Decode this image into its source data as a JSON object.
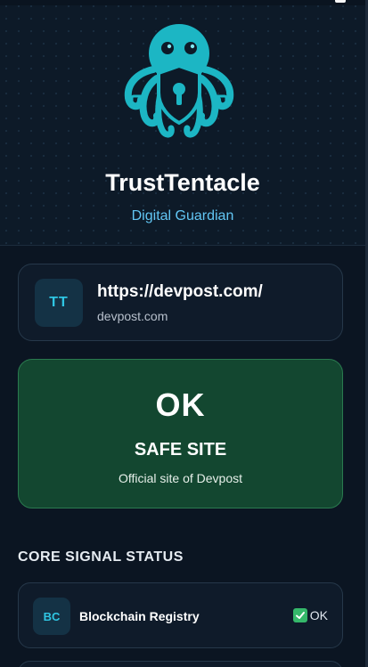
{
  "app": {
    "name": "TrustTentacle",
    "tagline": "Digital Guardian"
  },
  "site": {
    "avatar_text": "TT",
    "url": "https://devpost.com/",
    "domain": "devpost.com"
  },
  "verdict": {
    "status": "OK",
    "title": "SAFE SITE",
    "description": "Official site of Devpost",
    "color": "#134730"
  },
  "signals": {
    "section_title": "CORE SIGNAL STATUS",
    "items": [
      {
        "icon_text": "BC",
        "label": "Blockchain Registry",
        "status": "OK",
        "status_icon": "check-icon"
      }
    ]
  },
  "colors": {
    "accent": "#2fc6e3",
    "tagline": "#62c6f4",
    "safe": "#35b86a"
  }
}
